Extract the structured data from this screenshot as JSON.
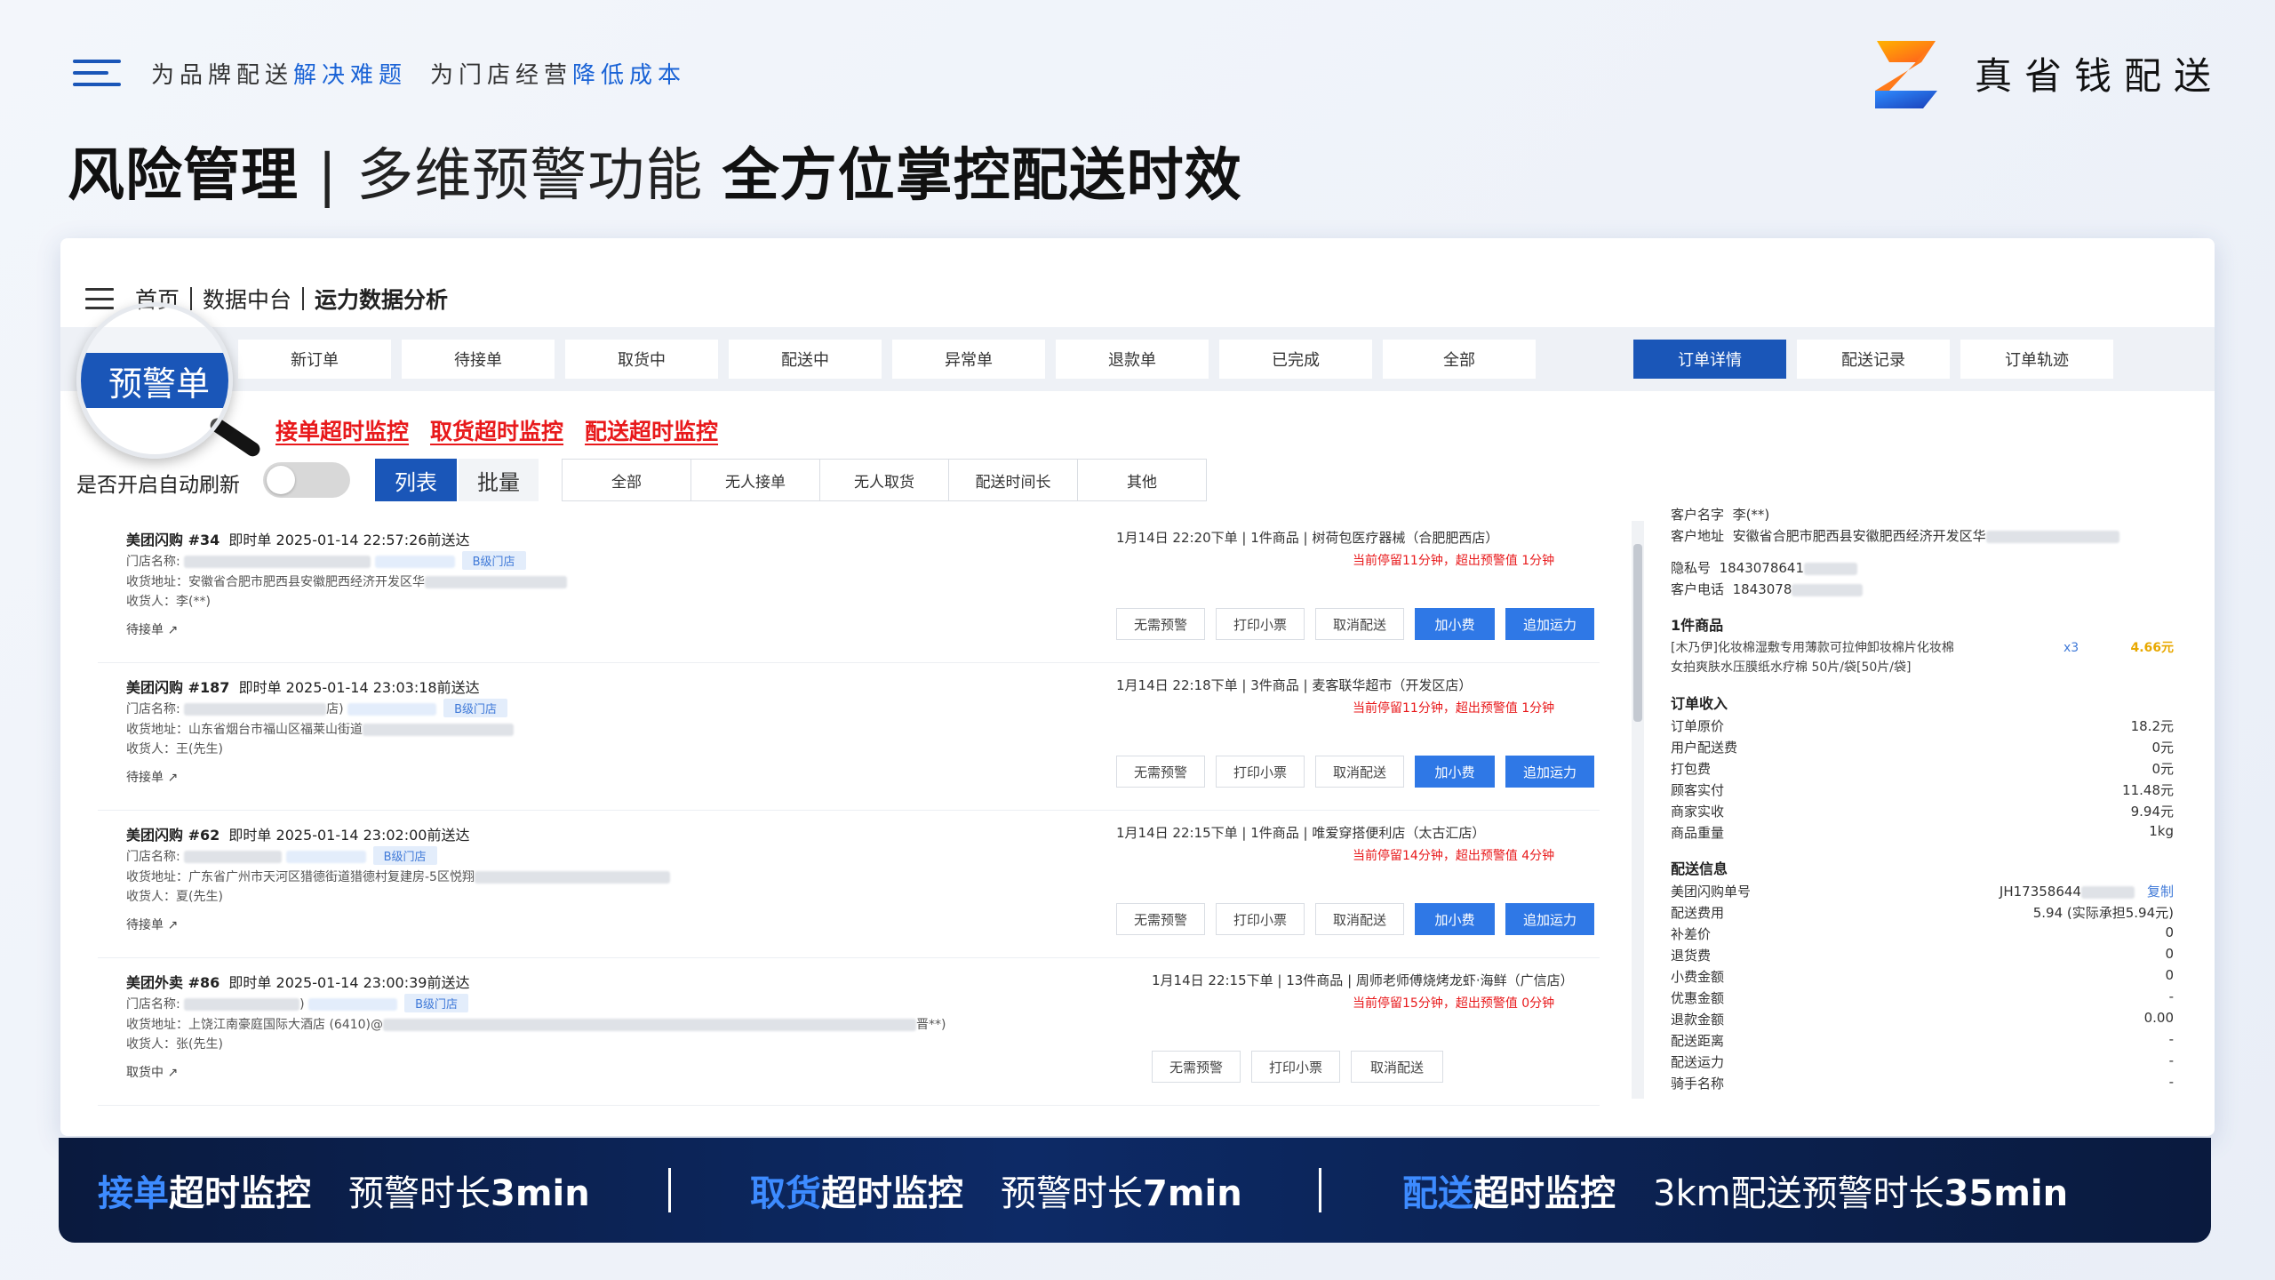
{
  "top": {
    "slogan_p1": "为品牌配送",
    "slogan_p2": "解决难题",
    "slogan_p3": "为门店经营",
    "slogan_p4": "降低成本",
    "brand_name": "真省钱配送"
  },
  "headline": {
    "part1": "风险管理",
    "sep": " | ",
    "part2": "多维预警功能 ",
    "part3": "全方位掌控配送时效"
  },
  "breadcrumb": {
    "home": "首页",
    "data": "数据中台",
    "current": "运力数据分析"
  },
  "tabs": {
    "warning": "预警单",
    "items": [
      "新订单",
      "待接单",
      "取货中",
      "配送中",
      "异常单",
      "退款单",
      "已完成",
      "全部"
    ],
    "detail_tabs": [
      "订单详情",
      "配送记录",
      "订单轨迹"
    ]
  },
  "monitors": [
    "接单超时监控",
    "取货超时监控",
    "配送超时监控"
  ],
  "refresh_label": "是否开启自动刷新",
  "view_buttons": [
    "列表",
    "批量"
  ],
  "filters": [
    "全部",
    "无人接单",
    "无人取货",
    "配送时间长",
    "其他"
  ],
  "orders": [
    {
      "title": "美团闪购 #34",
      "meta": "即时单 2025-01-14 22:57:26前送达",
      "store_label": "门店名称:",
      "tier": "B级门店",
      "address": "收货地址：安徽省合肥市肥西县安徽肥西经济开发区华",
      "receiver": "收货人：李(**)",
      "status": "待接单",
      "right_info": "1月14日 22:20下单 | 1件商品 | 树荷包医疗器械（合肥肥西店）",
      "warning": "当前停留11分钟，超出预警值 1分钟",
      "actions": [
        "无需预警",
        "打印小票",
        "取消配送",
        "加小费",
        "追加运力"
      ]
    },
    {
      "title": "美团闪购 #187",
      "meta": "即时单 2025-01-14 23:03:18前送达",
      "store_label": "门店名称:",
      "store_suffix": "店)",
      "tier": "B级门店",
      "address": "收货地址：山东省烟台市福山区福莱山街道",
      "receiver": "收货人：王(先生)",
      "status": "待接单",
      "right_info": "1月14日 22:18下单 | 3件商品 | 麦客联华超市（开发区店）",
      "warning": "当前停留11分钟，超出预警值 1分钟",
      "actions": [
        "无需预警",
        "打印小票",
        "取消配送",
        "加小费",
        "追加运力"
      ]
    },
    {
      "title": "美团闪购 #62",
      "meta": "即时单 2025-01-14 23:02:00前送达",
      "store_label": "门店名称:",
      "tier": "B级门店",
      "address": "收货地址：广东省广州市天河区猎德街道猎德村复建房-5区悦翔",
      "receiver": "收货人：夏(先生)",
      "status": "待接单",
      "right_info": "1月14日 22:15下单 | 1件商品 | 唯爱穿搭便利店（太古汇店）",
      "warning": "当前停留14分钟，超出预警值 4分钟",
      "actions": [
        "无需预警",
        "打印小票",
        "取消配送",
        "加小费",
        "追加运力"
      ]
    },
    {
      "title": "美团外卖 #86",
      "meta": "即时单 2025-01-14 23:00:39前送达",
      "store_label": "门店名称:",
      "store_suffix": ")",
      "tier": "B级门店",
      "address": "收货地址：上饶江南豪庭国际大酒店 (6410)@",
      "address_tail": "晋**)",
      "receiver": "收货人：张(先生)",
      "status": "取货中",
      "right_info": "1月14日 22:15下单 | 13件商品 | 周师老师傅烧烤龙虾·海鲜（广信店）",
      "warning": "当前停留15分钟，超出预警值 0分钟",
      "actions": [
        "无需预警",
        "打印小票",
        "取消配送"
      ]
    }
  ],
  "detail": {
    "cust_name_label": "客户名字",
    "cust_name_value": "李(**)",
    "address_label": "客户地址",
    "address_value": "安徽省合肥市肥西县安徽肥西经济开发区华",
    "privacy_label": "隐私号",
    "privacy_value": "1843078641",
    "phone_label": "客户电话",
    "phone_value": "1843078",
    "goods_header": "1件商品",
    "goods_line1": "[木乃伊]化妆棉湿敷专用薄款可拉伸卸妆棉片化妆棉",
    "goods_line2": "女拍爽肤水压膜纸水疗棉 50片/袋[50片/袋]",
    "goods_qty": "x3",
    "goods_price": "4.66元",
    "income_header": "订单收入",
    "income": [
      {
        "label": "订单原价",
        "value": "18.2元"
      },
      {
        "label": "用户配送费",
        "value": "0元"
      },
      {
        "label": "打包费",
        "value": "0元"
      },
      {
        "label": "顾客实付",
        "value": "11.48元"
      },
      {
        "label": "商家实收",
        "value": "9.94元"
      },
      {
        "label": "商品重量",
        "value": "1kg"
      }
    ],
    "delivery_header": "配送信息",
    "delivery_no_label": "美团闪购单号",
    "delivery_no_value": "JH17358644",
    "copy_label": "复制",
    "delivery": [
      {
        "label": "配送费用",
        "value": "5.94 (实际承担5.94元)"
      },
      {
        "label": "补差价",
        "value": "0"
      },
      {
        "label": "退货费",
        "value": "0"
      },
      {
        "label": "小费金额",
        "value": "0"
      },
      {
        "label": "优惠金额",
        "value": "-"
      },
      {
        "label": "退款金额",
        "value": "0.00"
      },
      {
        "label": "配送距离",
        "value": "-"
      },
      {
        "label": "配送运力",
        "value": "-"
      },
      {
        "label": "骑手名称",
        "value": "-"
      }
    ]
  },
  "bottom": [
    {
      "a": "接单",
      "b": "超时监控",
      "c1": "预警时长",
      "c2": "3min"
    },
    {
      "a": "取货",
      "b": "超时监控",
      "c1": "预警时长",
      "c2": "7min"
    },
    {
      "a": "配送",
      "b": "超时监控",
      "c1": "3km配送预警时长",
      "c2": "35min"
    }
  ],
  "colors": {
    "primary": "#1a56b8",
    "accent_blue": "#1a63d6",
    "warning_red": "#e8191b",
    "bottom_bg": "#0d2a66"
  }
}
